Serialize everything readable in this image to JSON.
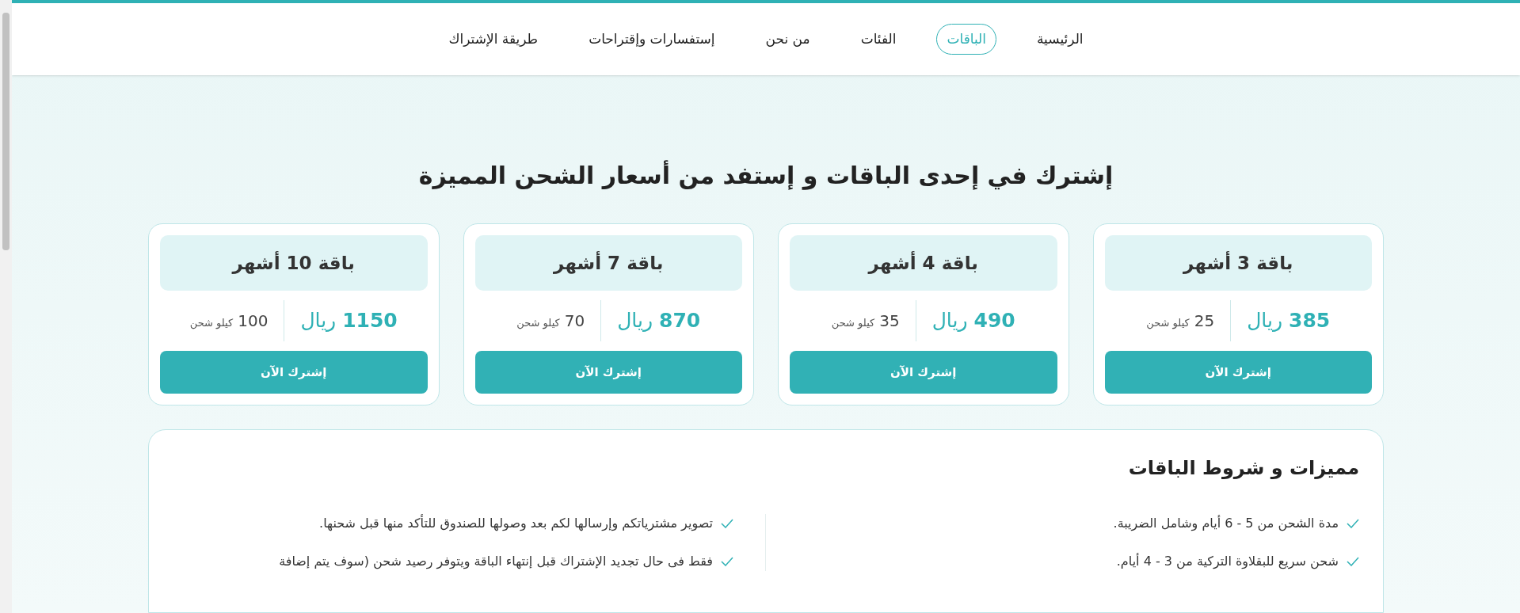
{
  "nav": [
    {
      "label": "الرئيسية",
      "selected": false
    },
    {
      "label": "الباقات",
      "selected": true
    },
    {
      "label": "الفئات",
      "selected": false
    },
    {
      "label": "من نحن",
      "selected": false
    },
    {
      "label": "إستفسارات وإقتراحات",
      "selected": false
    },
    {
      "label": "طريقة الإشتراك",
      "selected": false
    }
  ],
  "heading": "إشترك في إحدى الباقات و إستفد من أسعار الشحن المميزة",
  "plans": [
    {
      "title": "باقة 3 أشهر",
      "price": "385",
      "currency": "ريال",
      "weight": "25",
      "unit": "كيلو شحن",
      "button": "إشترك الآن"
    },
    {
      "title": "باقة 4 أشهر",
      "price": "490",
      "currency": "ريال",
      "weight": "35",
      "unit": "كيلو شحن",
      "button": "إشترك الآن"
    },
    {
      "title": "باقة 7 أشهر",
      "price": "870",
      "currency": "ريال",
      "weight": "70",
      "unit": "كيلو شحن",
      "button": "إشترك الآن"
    },
    {
      "title": "باقة 10 أشهر",
      "price": "1150",
      "currency": "ريال",
      "weight": "100",
      "unit": "كيلو شحن",
      "button": "إشترك الآن"
    }
  ],
  "features": {
    "title": "مميزات و شروط الباقات",
    "columns": [
      [
        "مدة الشحن من 5 - 6 أيام وشامل الضريبة.",
        "شحن سريع للبقلاوة التركية من 3 - 4 أيام."
      ],
      [
        "تصوير مشترياتكم وإرسالها لكم بعد وصولها للصندوق للتأكد منها قبل شحنها.",
        "فقط فى حال تجديد الإشتراك قبل إنتهاء الباقة ويتوفر رصيد شحن (سوف يتم إضافة"
      ]
    ]
  }
}
